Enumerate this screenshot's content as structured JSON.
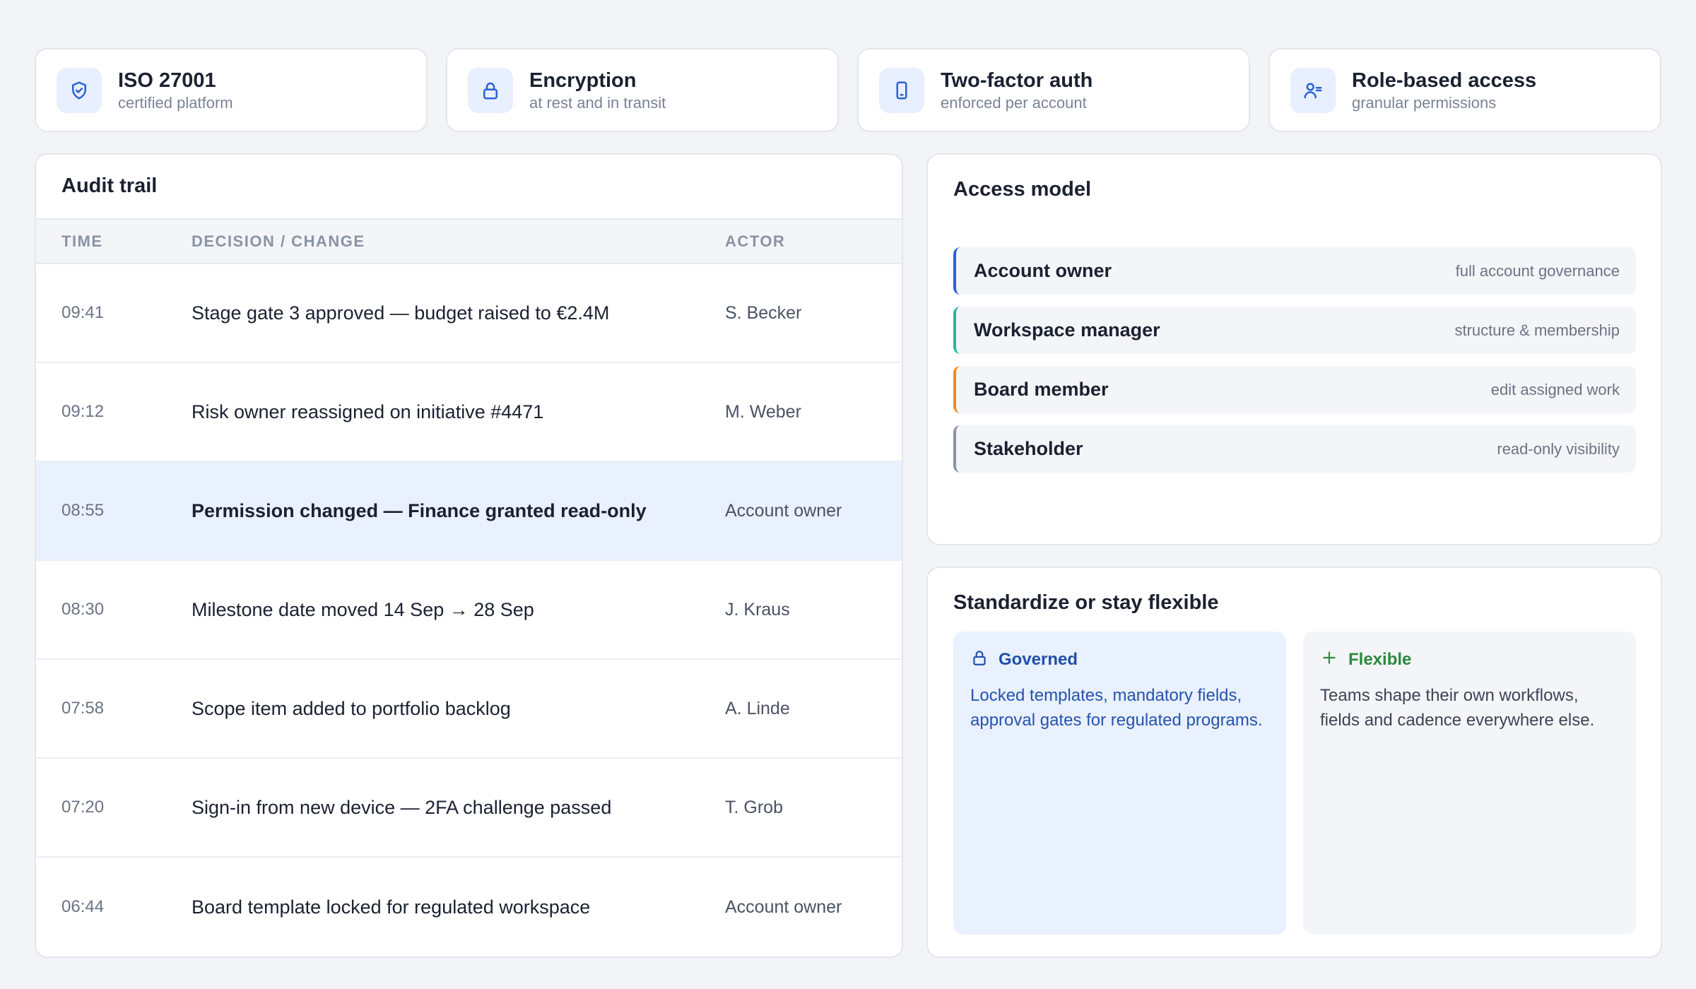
{
  "badges": [
    {
      "icon": "shield-check-icon",
      "title": "ISO 27001",
      "subtitle": "certified platform"
    },
    {
      "icon": "lock-icon",
      "title": "Encryption",
      "subtitle": "at rest and in transit"
    },
    {
      "icon": "phone-icon",
      "title": "Two-factor auth",
      "subtitle": "enforced per account"
    },
    {
      "icon": "user-roles-icon",
      "title": "Role-based access",
      "subtitle": "granular permissions"
    }
  ],
  "audit": {
    "title": "Audit trail",
    "columns": {
      "time": "TIME",
      "change": "DECISION / CHANGE",
      "actor": "ACTOR"
    },
    "rows": [
      {
        "time": "09:41",
        "change": "Stage gate 3 approved — budget raised to €2.4M",
        "actor": "S. Becker"
      },
      {
        "time": "09:12",
        "change": "Risk owner reassigned on initiative #4471",
        "actor": "M. Weber"
      },
      {
        "time": "08:55",
        "change": "Permission changed — Finance granted read-only",
        "actor": "Account owner"
      },
      {
        "time": "08:30",
        "change": "Milestone date moved 14 Sep → 28 Sep",
        "actor": "J. Kraus"
      },
      {
        "time": "07:58",
        "change": "Scope item added to portfolio backlog",
        "actor": "A. Linde"
      },
      {
        "time": "07:20",
        "change": "Sign-in from new device — 2FA challenge passed",
        "actor": "T. Grob"
      },
      {
        "time": "06:44",
        "change": "Board template locked for regulated workspace",
        "actor": "Account owner"
      }
    ],
    "highlighted_row": 2
  },
  "access": {
    "title": "Access model",
    "roles": [
      {
        "name": "Account owner",
        "description": "full account governance",
        "color": "#2a62d4"
      },
      {
        "name": "Workspace manager",
        "description": "structure & membership",
        "color": "#2bb39a"
      },
      {
        "name": "Board member",
        "description": "edit assigned work",
        "color": "#f08a24"
      },
      {
        "name": "Stakeholder",
        "description": "read-only visibility",
        "color": "#8a93a4"
      }
    ]
  },
  "standardize": {
    "title": "Standardize or stay flexible",
    "governed": {
      "icon": "lock-icon",
      "label": "Governed",
      "body": "Locked templates, mandatory fields, approval gates for regulated programs."
    },
    "flexible": {
      "icon": "plus-icon",
      "label": "Flexible",
      "body": "Teams shape their own workflows, fields and cadence everywhere else."
    }
  },
  "colors": {
    "accent": "#2a62d4",
    "highlight_row": "#e9f0fe",
    "flexible_green": "#2a8a3e"
  }
}
